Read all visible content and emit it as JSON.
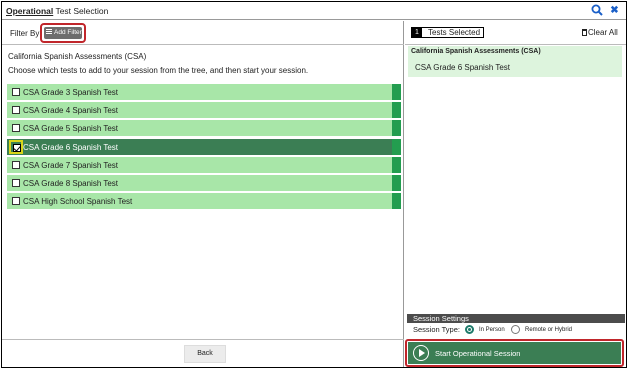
{
  "window": {
    "title_bold": "Operational",
    "title_rest": " Test Selection",
    "search_icon": "search-icon",
    "close_icon": "close-icon",
    "close_glyph": "✖"
  },
  "filter": {
    "label": "Filter By:",
    "add_filter_label": "Add Filter"
  },
  "main": {
    "group_title": "California Spanish Assessments (CSA)",
    "instructions": "Choose which tests to add to your session from the tree, and then start your session.",
    "tests": [
      {
        "label": "CSA Grade 3 Spanish Test",
        "checked": false
      },
      {
        "label": "CSA Grade 4 Spanish Test",
        "checked": false
      },
      {
        "label": "CSA Grade 5 Spanish Test",
        "checked": false
      },
      {
        "label": "CSA Grade 6 Spanish Test",
        "checked": true
      },
      {
        "label": "CSA Grade 7 Spanish Test",
        "checked": false
      },
      {
        "label": "CSA Grade 8 Spanish Test",
        "checked": false
      },
      {
        "label": "CSA High School Spanish Test",
        "checked": false
      }
    ],
    "back_label": "Back"
  },
  "selection": {
    "count": "1",
    "count_label": "Tests Selected",
    "clear_all_label": "Clear All",
    "group": "California Spanish Assessments (CSA)",
    "items": [
      "CSA Grade 6 Spanish Test"
    ]
  },
  "settings": {
    "header": "Session Settings",
    "session_type_label": "Session Type:",
    "options": [
      {
        "label": "In Person",
        "selected": true
      },
      {
        "label": "Remote or Hybrid",
        "selected": false
      }
    ],
    "start_label": "Start Operational Session"
  },
  "colors": {
    "row_bg": "#a8e6a8",
    "row_selected_bg": "#3b7e54",
    "accent_green": "#239d4f",
    "highlight_red": "#c0262b"
  }
}
